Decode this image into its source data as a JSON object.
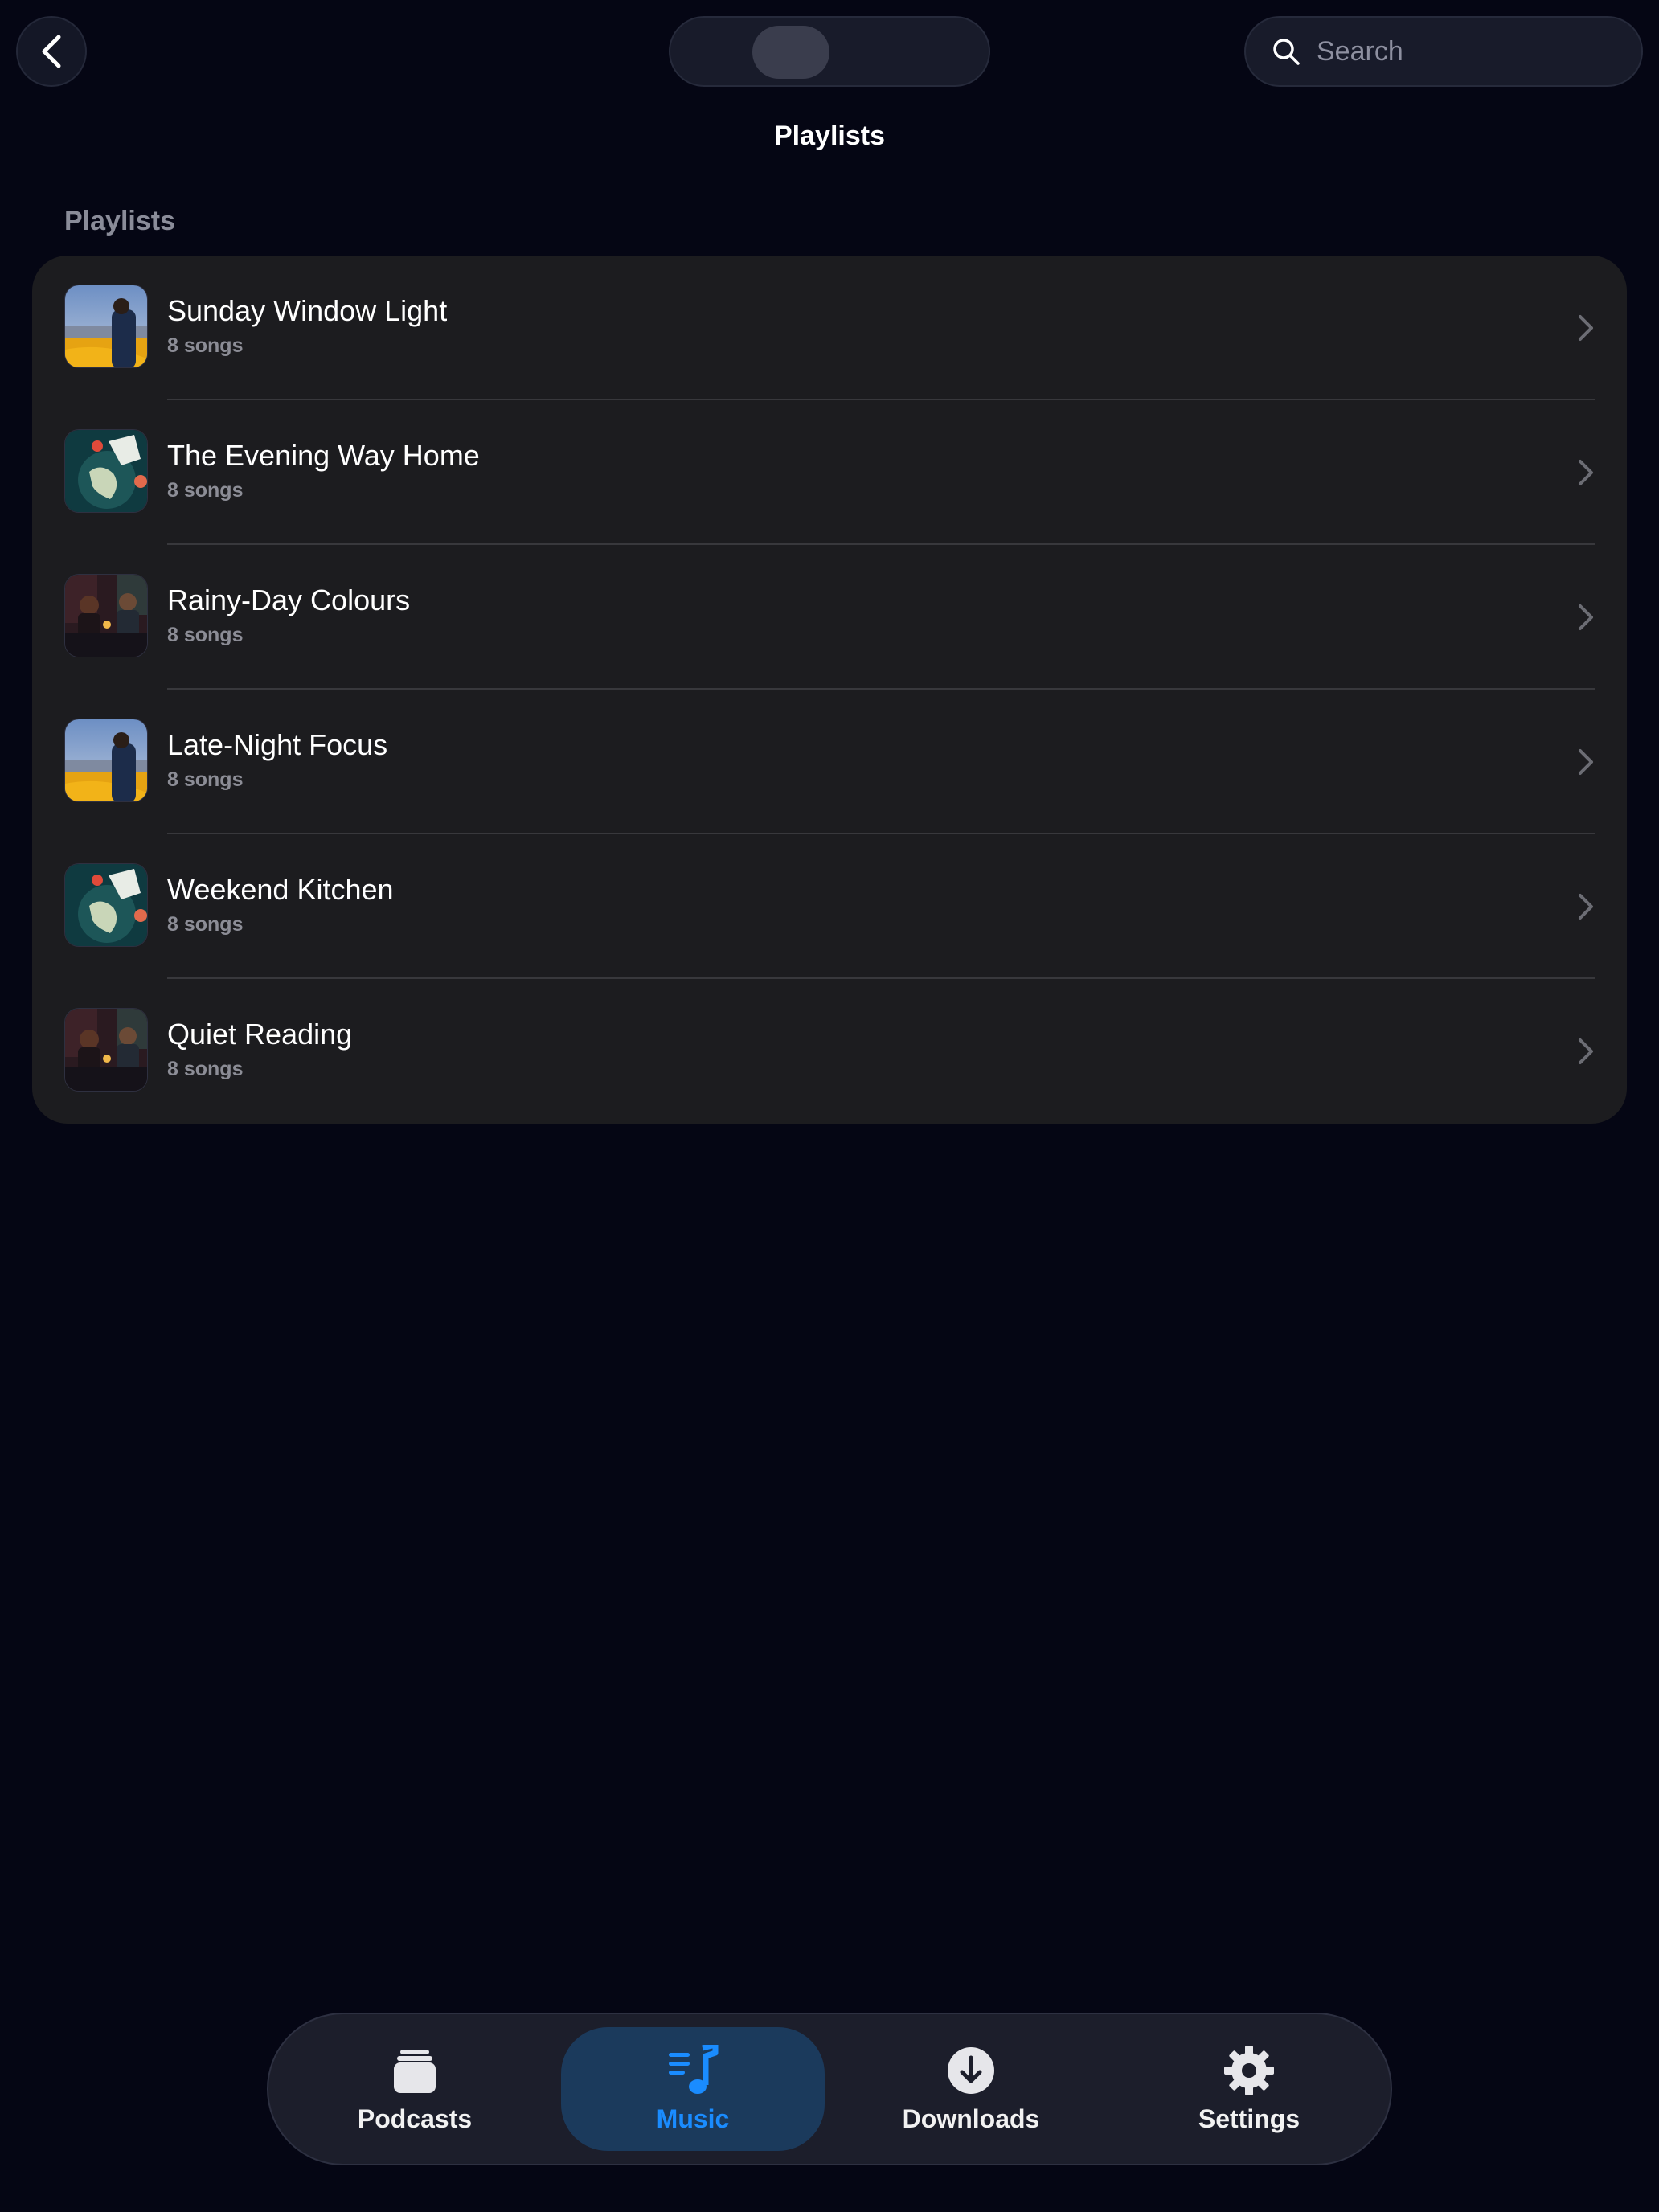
{
  "header": {
    "title": "Playlists",
    "search_placeholder": "Search"
  },
  "section": {
    "label": "Playlists"
  },
  "playlists": [
    {
      "title": "Sunday Window Light",
      "subtitle": "8 songs",
      "art": "city-window-art"
    },
    {
      "title": "The Evening Way Home",
      "subtitle": "8 songs",
      "art": "globe-collage-art"
    },
    {
      "title": "Rainy-Day Colours",
      "subtitle": "8 songs",
      "art": "dinner-scene-art"
    },
    {
      "title": "Late-Night Focus",
      "subtitle": "8 songs",
      "art": "city-window-art"
    },
    {
      "title": "Weekend Kitchen",
      "subtitle": "8 songs",
      "art": "globe-collage-art"
    },
    {
      "title": "Quiet Reading",
      "subtitle": "8 songs",
      "art": "dinner-scene-art"
    }
  ],
  "tabs": [
    {
      "label": "Podcasts",
      "icon": "stack-icon",
      "active": false
    },
    {
      "label": "Music",
      "icon": "music-list-icon",
      "active": true
    },
    {
      "label": "Downloads",
      "icon": "download-icon",
      "active": false
    },
    {
      "label": "Settings",
      "icon": "gear-icon",
      "active": false
    }
  ],
  "colors": {
    "background": "#050614",
    "card": "#1c1c1f",
    "accent": "#1a8cff",
    "active_tab_bg": "#1b3a5c"
  }
}
